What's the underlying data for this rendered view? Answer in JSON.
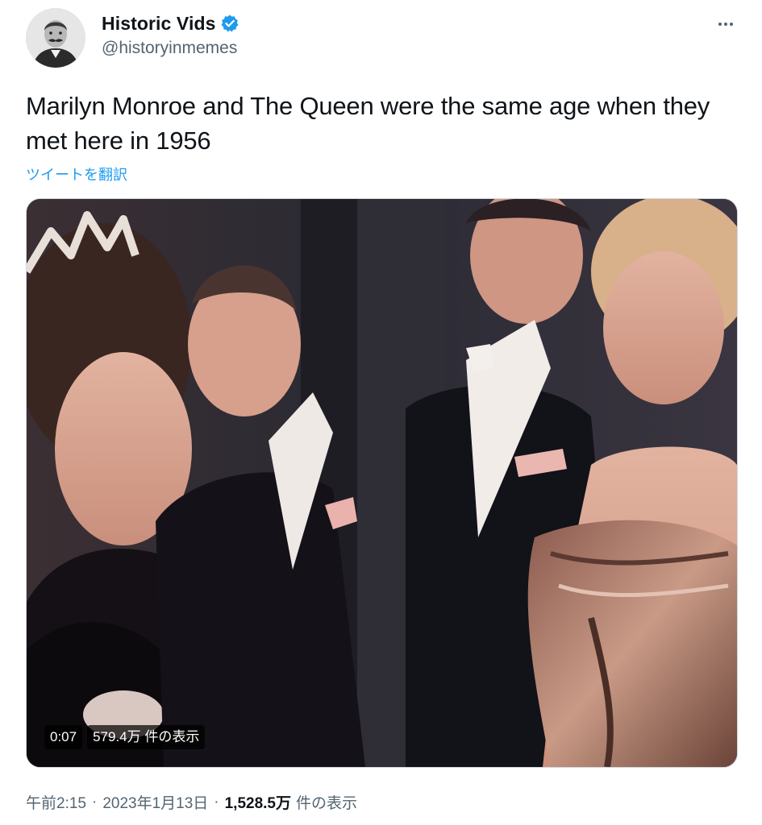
{
  "author": {
    "display_name": "Historic Vids",
    "handle": "@historyinmemes",
    "avatar_icon": "vintage-portrait-avatar",
    "verified_icon": "verified-badge-icon",
    "verified_color": "#1d9bf0"
  },
  "tweet": {
    "text": "Marilyn Monroe and The Queen were the same age when they met here in 1956",
    "translate_label": "ツイートを翻訳"
  },
  "media": {
    "type": "video",
    "duration": "0:07",
    "views_label": "579.4万 件の表示"
  },
  "meta": {
    "time": "午前2:15",
    "separator": "·",
    "date": "2023年1月13日",
    "views_count": "1,528.5万",
    "views_suffix": "件の表示"
  },
  "colors": {
    "link": "#1d9bf0",
    "secondary_text": "#536471",
    "primary_text": "#0f1419"
  }
}
